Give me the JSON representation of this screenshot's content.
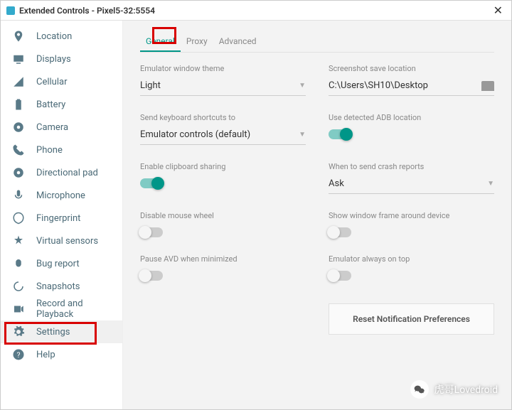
{
  "window": {
    "title": "Extended Controls - Pixel5-32:5554"
  },
  "sidebar": {
    "items": [
      {
        "label": "Location"
      },
      {
        "label": "Displays"
      },
      {
        "label": "Cellular"
      },
      {
        "label": "Battery"
      },
      {
        "label": "Camera"
      },
      {
        "label": "Phone"
      },
      {
        "label": "Directional pad"
      },
      {
        "label": "Microphone"
      },
      {
        "label": "Fingerprint"
      },
      {
        "label": "Virtual sensors"
      },
      {
        "label": "Bug report"
      },
      {
        "label": "Snapshots"
      },
      {
        "label": "Record and Playback"
      },
      {
        "label": "Settings"
      },
      {
        "label": "Help"
      }
    ]
  },
  "tabs": {
    "general": "General",
    "proxy": "Proxy",
    "advanced": "Advanced"
  },
  "settings": {
    "theme_label": "Emulator window theme",
    "theme_value": "Light",
    "screenshot_label": "Screenshot save location",
    "screenshot_value": "C:\\Users\\SH10\\Desktop",
    "shortcuts_label": "Send keyboard shortcuts to",
    "shortcuts_value": "Emulator controls (default)",
    "adb_label": "Use detected ADB location",
    "clipboard_label": "Enable clipboard sharing",
    "crash_label": "When to send crash reports",
    "crash_value": "Ask",
    "mouse_label": "Disable mouse wheel",
    "frame_label": "Show window frame around device",
    "pause_label": "Pause AVD when minimized",
    "ontop_label": "Emulator always on top",
    "reset_label": "Reset Notification Preferences"
  },
  "watermark": {
    "text": "虎哥Lovedroid"
  }
}
